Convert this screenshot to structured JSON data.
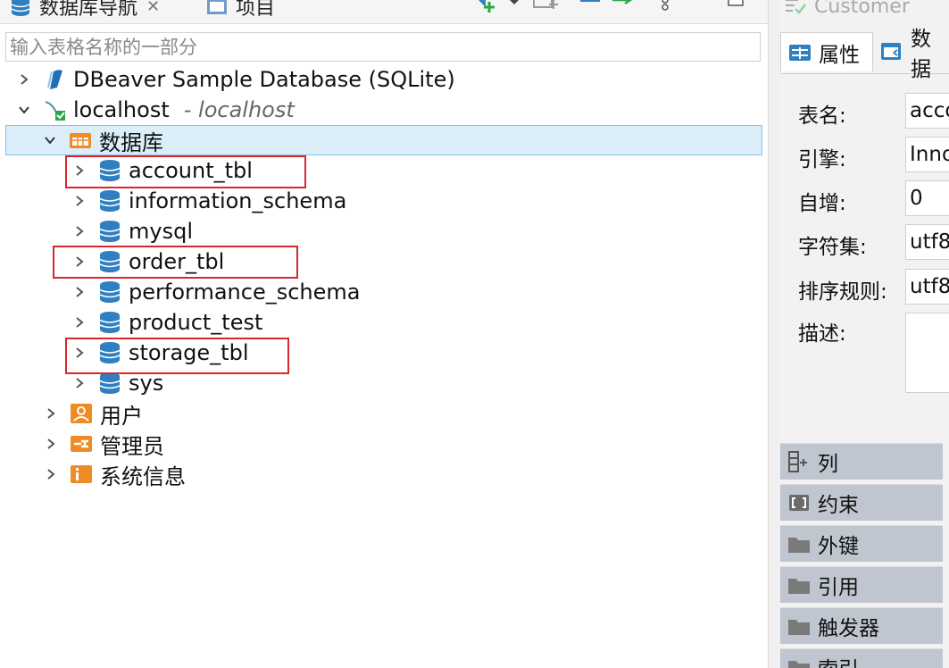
{
  "navigator": {
    "tab_title": "数据库导航",
    "tab2_title": "项目",
    "search_placeholder": "输入表格名称的一部分",
    "tree": {
      "sample_db": "DBeaver Sample Database (SQLite)",
      "localhost": {
        "label": "localhost",
        "sub": "- localhost"
      },
      "databases_folder": "数据库",
      "databases": [
        "account_tbl",
        "information_schema",
        "mysql",
        "order_tbl",
        "performance_schema",
        "product_test",
        "storage_tbl",
        "sys"
      ],
      "users": "用户",
      "admins": "管理员",
      "sysinfo": "系统信息"
    },
    "highlighted": [
      "account_tbl",
      "order_tbl",
      "storage_tbl"
    ]
  },
  "properties": {
    "title": "Customer",
    "tabs": [
      "属性",
      "数据"
    ],
    "fields": [
      {
        "label": "表名:",
        "value": "acco"
      },
      {
        "label": "引擎:",
        "value": "Inno"
      },
      {
        "label": "自增:",
        "value": "0"
      },
      {
        "label": "字符集:",
        "value": "utf8"
      },
      {
        "label": "排序规则:",
        "value": "utf8"
      },
      {
        "label": "描述:",
        "value": ""
      }
    ],
    "sections": [
      "列",
      "约束",
      "外键",
      "引用",
      "触发器",
      "索引"
    ]
  },
  "colors": {
    "selection": "#dbeefa",
    "highlight_box": "#d9272e",
    "db_icon": "#2f7fc1",
    "folder_orange": "#f08a24"
  }
}
